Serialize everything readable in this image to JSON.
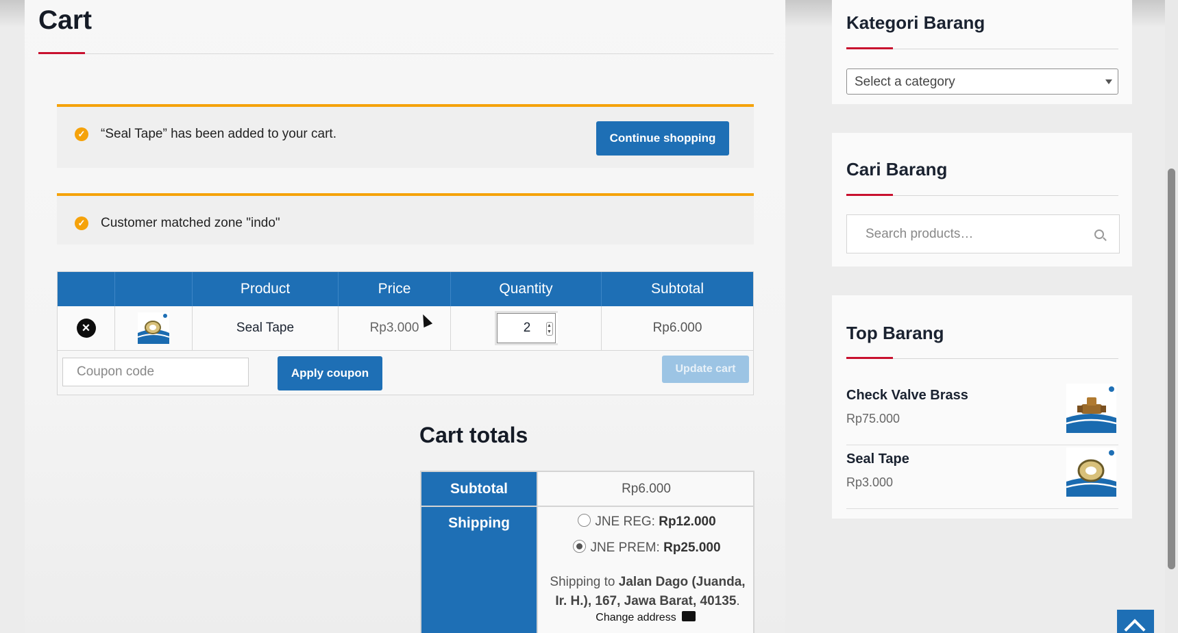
{
  "page": {
    "title": "Cart"
  },
  "notices": {
    "added_message": "“Seal Tape” has been added to your cart.",
    "continue_label": "Continue shopping",
    "zone_message": "Customer matched zone \"indo\""
  },
  "cart": {
    "headers": [
      "",
      "",
      "Product",
      "Price",
      "Quantity",
      "Subtotal"
    ],
    "items": [
      {
        "name": "Seal Tape",
        "price": "Rp3.000",
        "quantity": "2",
        "subtotal": "Rp6.000"
      }
    ],
    "coupon_placeholder": "Coupon code",
    "apply_label": "Apply coupon",
    "update_label": "Update cart"
  },
  "totals": {
    "title": "Cart totals",
    "subtotal_label": "Subtotal",
    "subtotal_value": "Rp6.000",
    "shipping_label": "Shipping",
    "options": [
      {
        "name": "JNE REG:",
        "price": "Rp12.000",
        "selected": false
      },
      {
        "name": "JNE PREM:",
        "price": "Rp25.000",
        "selected": true
      }
    ],
    "shipping_to_prefix": "Shipping to",
    "shipping_address": "Jalan Dago (Juanda, Ir. H.), 167, Jawa Barat, 40135",
    "shipping_to_suffix": ".",
    "change_address": "Change address"
  },
  "sidebar": {
    "category_title": "Kategori Barang",
    "category_placeholder": "Select a category",
    "search_title": "Cari Barang",
    "search_placeholder": "Search products…",
    "top_title": "Top Barang",
    "top_items": [
      {
        "name": "Check Valve Brass",
        "price": "Rp75.000"
      },
      {
        "name": "Seal Tape",
        "price": "Rp3.000"
      }
    ]
  },
  "colors": {
    "accent": "#1e6fb5",
    "notice": "#f5a20a",
    "underline": "#c8102e"
  }
}
